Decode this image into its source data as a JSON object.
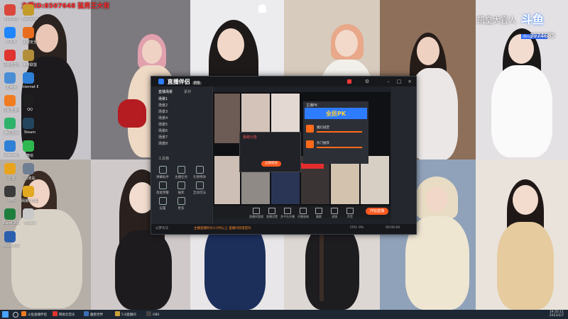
{
  "overlay": {
    "red_text": "主播ID:8507648 猛男王大有",
    "watermark": "凯皇大官人",
    "douyu_logo": "斗鱼",
    "douyu_sub": "douyu.com",
    "room_number": "3974685"
  },
  "desktop": {
    "icons": [
      {
        "label": "ELEVEN",
        "color": "#d9463b"
      },
      {
        "label": "KOOK",
        "color": "#1f86ff"
      },
      {
        "label": "网易云音乐",
        "color": "#e0342f"
      },
      {
        "label": "此电脑",
        "color": "#4b8ed6"
      },
      {
        "label": "斗鱼直播伴侣",
        "color": "#f07c22"
      },
      {
        "label": "腾讯视频",
        "color": "#2fb26a"
      },
      {
        "label": "Internet Explorer",
        "color": "#2e7fd6"
      },
      {
        "label": "迅雷",
        "color": "#e8a41d"
      },
      {
        "label": "OBS",
        "color": "#3b3b3b"
      },
      {
        "label": "Excel 2007",
        "color": "#1e7e3e"
      },
      {
        "label": "Word 2007",
        "color": "#2a5fae"
      },
      {
        "label": "WeGame",
        "color": "#c49b2b"
      },
      {
        "label": "火绒安全",
        "color": "#e86d1f"
      },
      {
        "label": "英雄联盟",
        "color": "#b28e3a"
      },
      {
        "label": "Internet Explorer",
        "color": "#2e7fd6"
      },
      {
        "label": "QQ",
        "color": "#1e1e1e"
      },
      {
        "label": "Steam",
        "color": "#23455e"
      },
      {
        "label": "微信",
        "color": "#2fb84f"
      },
      {
        "label": "回收站",
        "color": "#6f7f93"
      },
      {
        "label": "网易UU加速器",
        "color": "#e2a920"
      },
      {
        "label": "Typora",
        "color": "#c9c9c9"
      }
    ]
  },
  "app": {
    "title": "直播伴侣",
    "badge": "新版",
    "left_tabs": [
      "直播场景",
      "素材"
    ],
    "scenes": [
      "场景1",
      "场景2",
      "场景3",
      "场景4",
      "场景5",
      "场景6",
      "场景7",
      "场景8"
    ],
    "tools_title": "工具箱",
    "tools": [
      "弹幕助手",
      "主播任务",
      "礼物特效",
      "高能预警",
      "抽奖",
      "互动玩法",
      "设置",
      "更多"
    ],
    "bottom_tools": [
      "直播间管理",
      "直播设置",
      "多平台开播",
      "开播录制",
      "美颜",
      "滤镜",
      "声音"
    ],
    "start_live": "开始直播",
    "notice_title": "系统公告",
    "notice_text": "直播间通知:您的直播间已设置为精选推荐",
    "notice_button": "立即前往",
    "pk_title": "主播PK",
    "pk_banner": "全民PK",
    "pk_items": [
      "魔幻城堡",
      "热门推荐"
    ],
    "status_left": "以梦为马",
    "status_mid": "主播直播时长1小时以上  直播间热度提升",
    "status_right": "00:00:00",
    "cpu": "CPU: 9%"
  },
  "taskbar": {
    "items": [
      {
        "label": "斗鱼直播伴侣",
        "color": "#f07c22"
      },
      {
        "label": "网易云音乐",
        "color": "#e0342f"
      },
      {
        "label": "魔兽世界",
        "color": "#3a6fb5"
      },
      {
        "label": "5.8直播间",
        "color": "#c9a13a"
      },
      {
        "label": "OBS",
        "color": "#444"
      }
    ],
    "time": "19:35:11",
    "date": "2023/2/7"
  }
}
